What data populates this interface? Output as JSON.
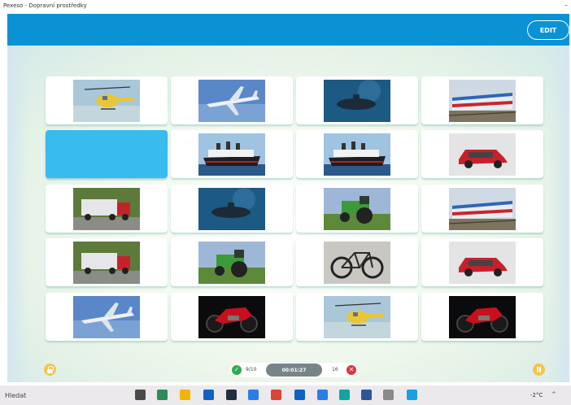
{
  "window": {
    "title": "Pexeso - Dopravní prostředky"
  },
  "header": {
    "edit_label": "EDIT"
  },
  "grid": [
    [
      "helicopter",
      "airplane",
      "submarine",
      "train"
    ],
    [
      "hidden",
      "ship",
      "ship",
      "car"
    ],
    [
      "truck",
      "submarine",
      "tractor",
      "train"
    ],
    [
      "truck",
      "tractor",
      "bicycle",
      "car"
    ],
    [
      "airplane",
      "motorcycle",
      "helicopter",
      "motorcycle"
    ]
  ],
  "status": {
    "matched": "9/10",
    "timer": "00:01:27",
    "misses": "16"
  },
  "taskbar": {
    "search_text": "Hledat",
    "weather": "-2°C",
    "tray_chevron": "^"
  },
  "colors": {
    "header": "#0a92d4",
    "hidden_card": "#38bbed",
    "ok": "#2eab4e",
    "error": "#e0323e",
    "timer_bg": "#798489",
    "accent": "#f7c44a"
  }
}
